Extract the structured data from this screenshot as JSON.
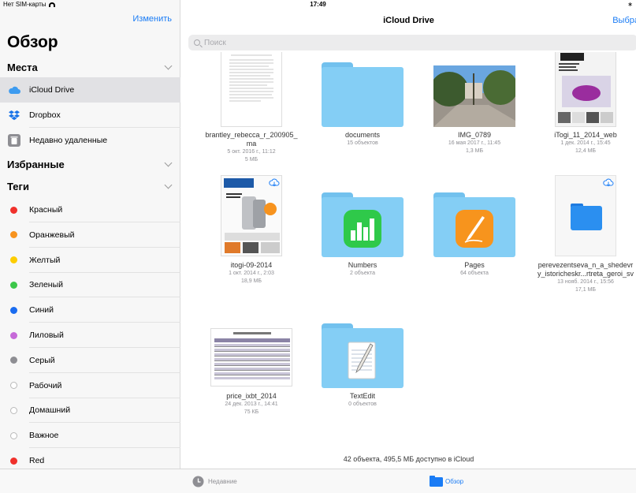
{
  "status": {
    "carrier": "Нет SIM-карты",
    "time": "17:49",
    "battery": "∗"
  },
  "sidebar": {
    "edit_label": "Изменить",
    "title": "Обзор",
    "places_header": "Места",
    "places": [
      {
        "label": "iCloud Drive",
        "icon": "icloud-icon",
        "selected": true
      },
      {
        "label": "Dropbox",
        "icon": "dropbox-icon"
      },
      {
        "label": "Недавно удаленные",
        "icon": "trash-icon"
      }
    ],
    "favorites_header": "Избранные",
    "tags_header": "Теги",
    "tags": [
      {
        "label": "Красный",
        "color": "#f0312c"
      },
      {
        "label": "Оранжевый",
        "color": "#f7931e"
      },
      {
        "label": "Желтый",
        "color": "#fdcd00"
      },
      {
        "label": "Зеленый",
        "color": "#3cc74a"
      },
      {
        "label": "Синий",
        "color": "#1a6cf0"
      },
      {
        "label": "Лиловый",
        "color": "#c66ad8"
      },
      {
        "label": "Серый",
        "color": "#8e8e93"
      },
      {
        "label": "Рабочий",
        "color": null
      },
      {
        "label": "Домашний",
        "color": null
      },
      {
        "label": "Важное",
        "color": null
      },
      {
        "label": "Red",
        "color": "#f0312c"
      }
    ]
  },
  "main": {
    "title": "iCloud Drive",
    "select_label": "Выбра",
    "search_placeholder": "Поиск",
    "items": [
      {
        "name": "brantley_rebecca_r_200905_\nma",
        "meta1": "5 окт. 2016 г., 11:12",
        "meta2": "5 МБ"
      },
      {
        "name": "documents",
        "meta1": "15 объектов",
        "meta2": ""
      },
      {
        "name": "IMG_0789",
        "meta1": "16 мая 2017 г., 11:45",
        "meta2": "1,3 МБ"
      },
      {
        "name": "iTogi_11_2014_web",
        "meta1": "1 дек. 2014 г., 15:45",
        "meta2": "12,4 МБ"
      },
      {
        "name": "itogi-09-2014",
        "meta1": "1 окт. 2014 г., 2:03",
        "meta2": "18,9 МБ"
      },
      {
        "name": "Numbers",
        "meta1": "2 объекта",
        "meta2": ""
      },
      {
        "name": "Pages",
        "meta1": "64 объекта",
        "meta2": ""
      },
      {
        "name": "perevezentseva_n_a_shedevr\ny_istoricheskr...rtreta_geroi_sv",
        "meta1": "13 нояб. 2014 г., 15:56",
        "meta2": "17,1 МБ"
      },
      {
        "name": "price_ixbt_2014",
        "meta1": "24 дек. 2013 г., 14:41",
        "meta2": "75 КБ"
      },
      {
        "name": "TextEdit",
        "meta1": "0 объектов",
        "meta2": ""
      }
    ],
    "footer": "42 объекта, 495,5 МБ доступно в iCloud"
  },
  "tabbar": {
    "recent_label": "Недавние",
    "browse_label": "Обзор"
  }
}
